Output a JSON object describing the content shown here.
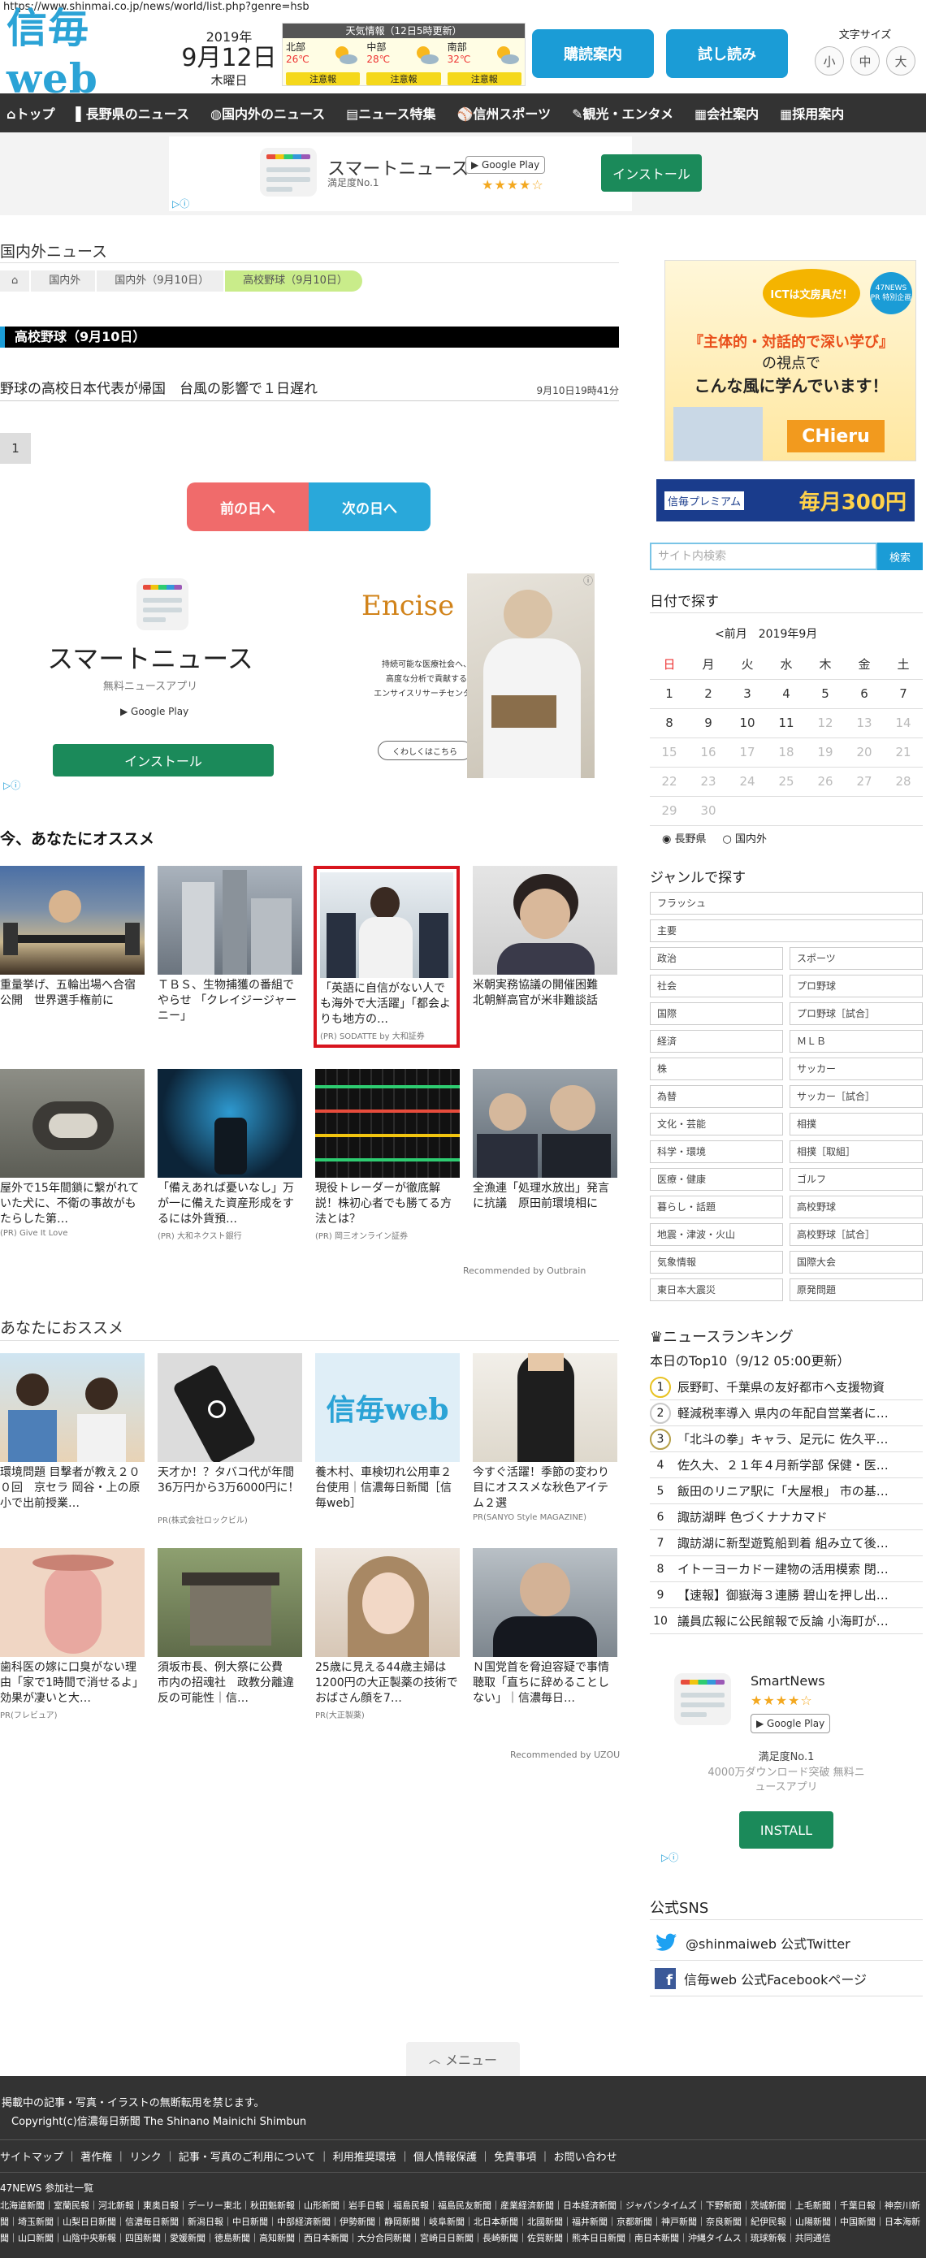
{
  "url": "https://www.shinmai.co.jp/news/world/list.php?genre=hsb",
  "logo": {
    "text": "信毎web"
  },
  "date": {
    "year": "2019年",
    "main": "9月12日",
    "weekday": "木曜日"
  },
  "weather": {
    "title": "天気情報（12日5時更新）",
    "regions": [
      {
        "name": "北部",
        "temp": "26℃",
        "warn": "注意報"
      },
      {
        "name": "中部",
        "temp": "28℃",
        "warn": "注意報"
      },
      {
        "name": "南部",
        "temp": "32℃",
        "warn": "注意報"
      }
    ]
  },
  "header_buttons": {
    "subscribe": "購読案内",
    "trial": "試し読み"
  },
  "font_size": {
    "label": "文字サイズ",
    "small": "小",
    "medium": "中",
    "large": "大"
  },
  "nav": [
    "トップ",
    "長野県のニュース",
    "国内外のニュース",
    "ニュース特集",
    "信州スポーツ",
    "観光・エンタメ",
    "会社案内",
    "採用案内"
  ],
  "top_ad": {
    "title": "スマートニュース",
    "sub": "満足度No.1",
    "store": "Google Play",
    "stars": "★★★★☆",
    "install": "インストール"
  },
  "section_title": "国内外ニュース",
  "breadcrumb": [
    "国内外",
    "国内外（9月10日）",
    "高校野球（9月10日）"
  ],
  "category_heading": "高校野球（9月10日）",
  "article": {
    "title": "野球の高校日本代表が帰国　台風の影響で１日遅れ",
    "time": "9月10日19時41分"
  },
  "pager": "1",
  "day_nav": {
    "prev": "前の日へ",
    "next": "次の日へ"
  },
  "big_ad_left": {
    "title": "スマートニュース",
    "sub": "無料ニュースアプリ",
    "store": "Google Play",
    "install": "インストール"
  },
  "big_ad_right": {
    "brand": "Encise",
    "line1": "持続可能な医療社会へ、",
    "line2": "高度な分析で貢献する",
    "line3": "エンサイスリサーチセンター",
    "more": "くわしくはこちら"
  },
  "recommend1": {
    "heading": "今、あなたにオススメ",
    "cards": [
      {
        "title": "重量挙げ、五輪出場へ合宿公開　世界選手権前に",
        "pr": ""
      },
      {
        "title": "ＴＢＳ、生物捕獲の番組でやらせ 「クレイジージャーニー」",
        "pr": ""
      },
      {
        "title": "「英語に自信がない人でも海外で大活躍」「都会よりも地方の…",
        "pr": "(PR) SODATTE by 大和証券"
      },
      {
        "title": "米朝実務協議の開催困難　北朝鮮高官が米非難談話",
        "pr": ""
      },
      {
        "title": "屋外で15年間鎖に繋がれていた犬に、不衛の事故がもたらした第…",
        "pr": "(PR) Give It Love"
      },
      {
        "title": "「備えあれば憂いなし」万が一に備えた資産形成をするには外貨預…",
        "pr": "(PR) 大和ネクスト銀行"
      },
      {
        "title": "現役トレーダーが徹底解説！株初心者でも勝てる方法とは？",
        "pr": "(PR) 岡三オンライン証券"
      },
      {
        "title": "全漁連「処理水放出」発言に抗議　原田前環境相に",
        "pr": ""
      }
    ],
    "recommended_by": "Recommended by Outbrain"
  },
  "recommend2": {
    "heading": "あなたにおススメ",
    "cards": [
      {
        "title": "環境問題 目撃者が教え２００回　京セラ 岡谷・上の原小で出前授業…",
        "pr": ""
      },
      {
        "title": "天才か！？タバコ代が年間36万円から3万6000円に！",
        "pr": "PR(株式会社ロックビル)"
      },
      {
        "title": "養木村、車検切れ公用車２台使用｜信濃毎日新聞［信毎web］",
        "pr": ""
      },
      {
        "title": "今すぐ活躍！季節の変わり目にオススメな秋色アイテム２選",
        "pr": "PR(SANYO Style MAGAZINE)"
      },
      {
        "title": "歯科医の嫁に口臭がない理由「家で1時間で消せるよ」効果が凄いと大…",
        "pr": "PR(フレビュア)"
      },
      {
        "title": "須坂市長、例大祭に公費　市内の招魂社　政教分離違反の可能性｜信…",
        "pr": ""
      },
      {
        "title": "25歳に見える44歳主婦は1200円の大正製薬の技術でおばさん顔を7…",
        "pr": "PR(大正製薬)"
      },
      {
        "title": "Ｎ国党首を脅迫容疑で事情聴取「直ちに辞めることしない」｜信濃毎日…",
        "pr": ""
      }
    ],
    "recommended_by": "Recommended by UZOU"
  },
  "side_ads": {
    "ict": {
      "badge": "ICTは文房具だ！",
      "line1": "『主体的・対話的で深い学び』",
      "line2": "の視点で",
      "line3": "こんな風に学んでいます！",
      "brand": "CHieru",
      "tag": "47NEWS PR 特別企画"
    },
    "premium": {
      "left": "信毎プレミアム",
      "right": "毎月300円"
    }
  },
  "search": {
    "placeholder": "サイト内検索",
    "button": "検索"
  },
  "calendar": {
    "heading": "日付で探す",
    "nav": "<前月　2019年9月",
    "weekdays": [
      "日",
      "月",
      "火",
      "水",
      "木",
      "金",
      "土"
    ],
    "weeks": [
      [
        "1",
        "2",
        "3",
        "4",
        "5",
        "6",
        "7"
      ],
      [
        "8",
        "9",
        "10",
        "11",
        "12",
        "13",
        "14"
      ],
      [
        "15",
        "16",
        "17",
        "18",
        "19",
        "20",
        "21"
      ],
      [
        "22",
        "23",
        "24",
        "25",
        "26",
        "27",
        "28"
      ],
      [
        "29",
        "30",
        "",
        "",
        "",
        "",
        ""
      ]
    ],
    "radios": [
      "長野県",
      "国内外"
    ]
  },
  "genre": {
    "heading": "ジャンルで探す",
    "items": [
      "フラッシュ",
      "主要",
      "政治",
      "スポーツ",
      "社会",
      "プロ野球",
      "国際",
      "プロ野球［試合］",
      "経済",
      "ＭＬＢ",
      "株",
      "サッカー",
      "為替",
      "サッカー［試合］",
      "文化・芸能",
      "相撲",
      "科学・環境",
      "相撲［取組］",
      "医療・健康",
      "ゴルフ",
      "暮らし・話題",
      "高校野球",
      "地震・津波・火山",
      "高校野球［試合］",
      "気象情報",
      "国際大会",
      "東日本大震災",
      "原発問題"
    ]
  },
  "ranking": {
    "heading": "ニュースランキング",
    "sub": "本日のTop10（9/12 05:00更新）",
    "items": [
      "辰野町、千葉県の友好都市へ支援物資",
      "軽減税率導入 県内の年配自営業者に…",
      "「北斗の拳」キャラ、足元に 佐久平…",
      "佐久大、２１年４月新学部 保健・医…",
      "飯田のリニア駅に「大屋根」 市の基…",
      "諏訪湖畔 色づくナナカマド",
      "諏訪湖に新型遊覧船到着 組み立て後…",
      "イトーヨーカドー建物の活用模索 閉…",
      "【速報】御嶽海３連勝 碧山を押し出…",
      "議員広報に公民館報で反論 小海町が…"
    ]
  },
  "side_app": {
    "name": "SmartNews",
    "stars": "★★★★☆",
    "store": "Google Play",
    "sub": "満足度No.1",
    "desc": "4000万ダウンロード突破 無料ニュースアプリ",
    "install": "INSTALL"
  },
  "sns": {
    "heading": "公式SNS",
    "twitter": "@shinmaiweb 公式Twitter",
    "facebook": "信毎web 公式Facebookページ"
  },
  "menu": "メニュー",
  "footer": {
    "notice": "掲載中の記事・写真・イラストの無断転用を禁じます。",
    "copyright": "Copyright(c)信濃毎日新聞 The Shinano Mainichi Shimbun",
    "links": [
      "サイトマップ",
      "著作権",
      "リンク",
      "記事・写真のご利用について",
      "利用推奨環境",
      "個人情報保護",
      "免責事項",
      "お問い合わせ"
    ],
    "network_title": "47NEWS 参加社一覧",
    "network": "北海道新聞｜室蘭民報｜河北新報｜東奥日報｜デーリー東北｜秋田魁新報｜山形新聞｜岩手日報｜福島民報｜福島民友新聞｜産業経済新聞｜日本経済新聞｜ジャパンタイムズ｜下野新聞｜茨城新聞｜上毛新聞｜千葉日報｜神奈川新聞｜埼玉新聞｜山梨日日新聞｜信濃毎日新聞｜新潟日報｜中日新聞｜中部経済新聞｜伊勢新聞｜静岡新聞｜岐阜新聞｜北日本新聞｜北國新聞｜福井新聞｜京都新聞｜神戸新聞｜奈良新聞｜紀伊民報｜山陽新聞｜中国新聞｜日本海新聞｜山口新聞｜山陰中央新報｜四国新聞｜愛媛新聞｜徳島新聞｜高知新聞｜西日本新聞｜大分合同新聞｜宮崎日日新聞｜長崎新聞｜佐賀新聞｜熊本日日新聞｜南日本新聞｜沖縄タイムス｜琉球新報｜共同通信"
  },
  "colors": {
    "brand": "#1b9cd6",
    "nav_bg": "#333333",
    "prev_day": "#f06b6b",
    "next_day": "#29a8da",
    "highlight": "#d8151e"
  }
}
